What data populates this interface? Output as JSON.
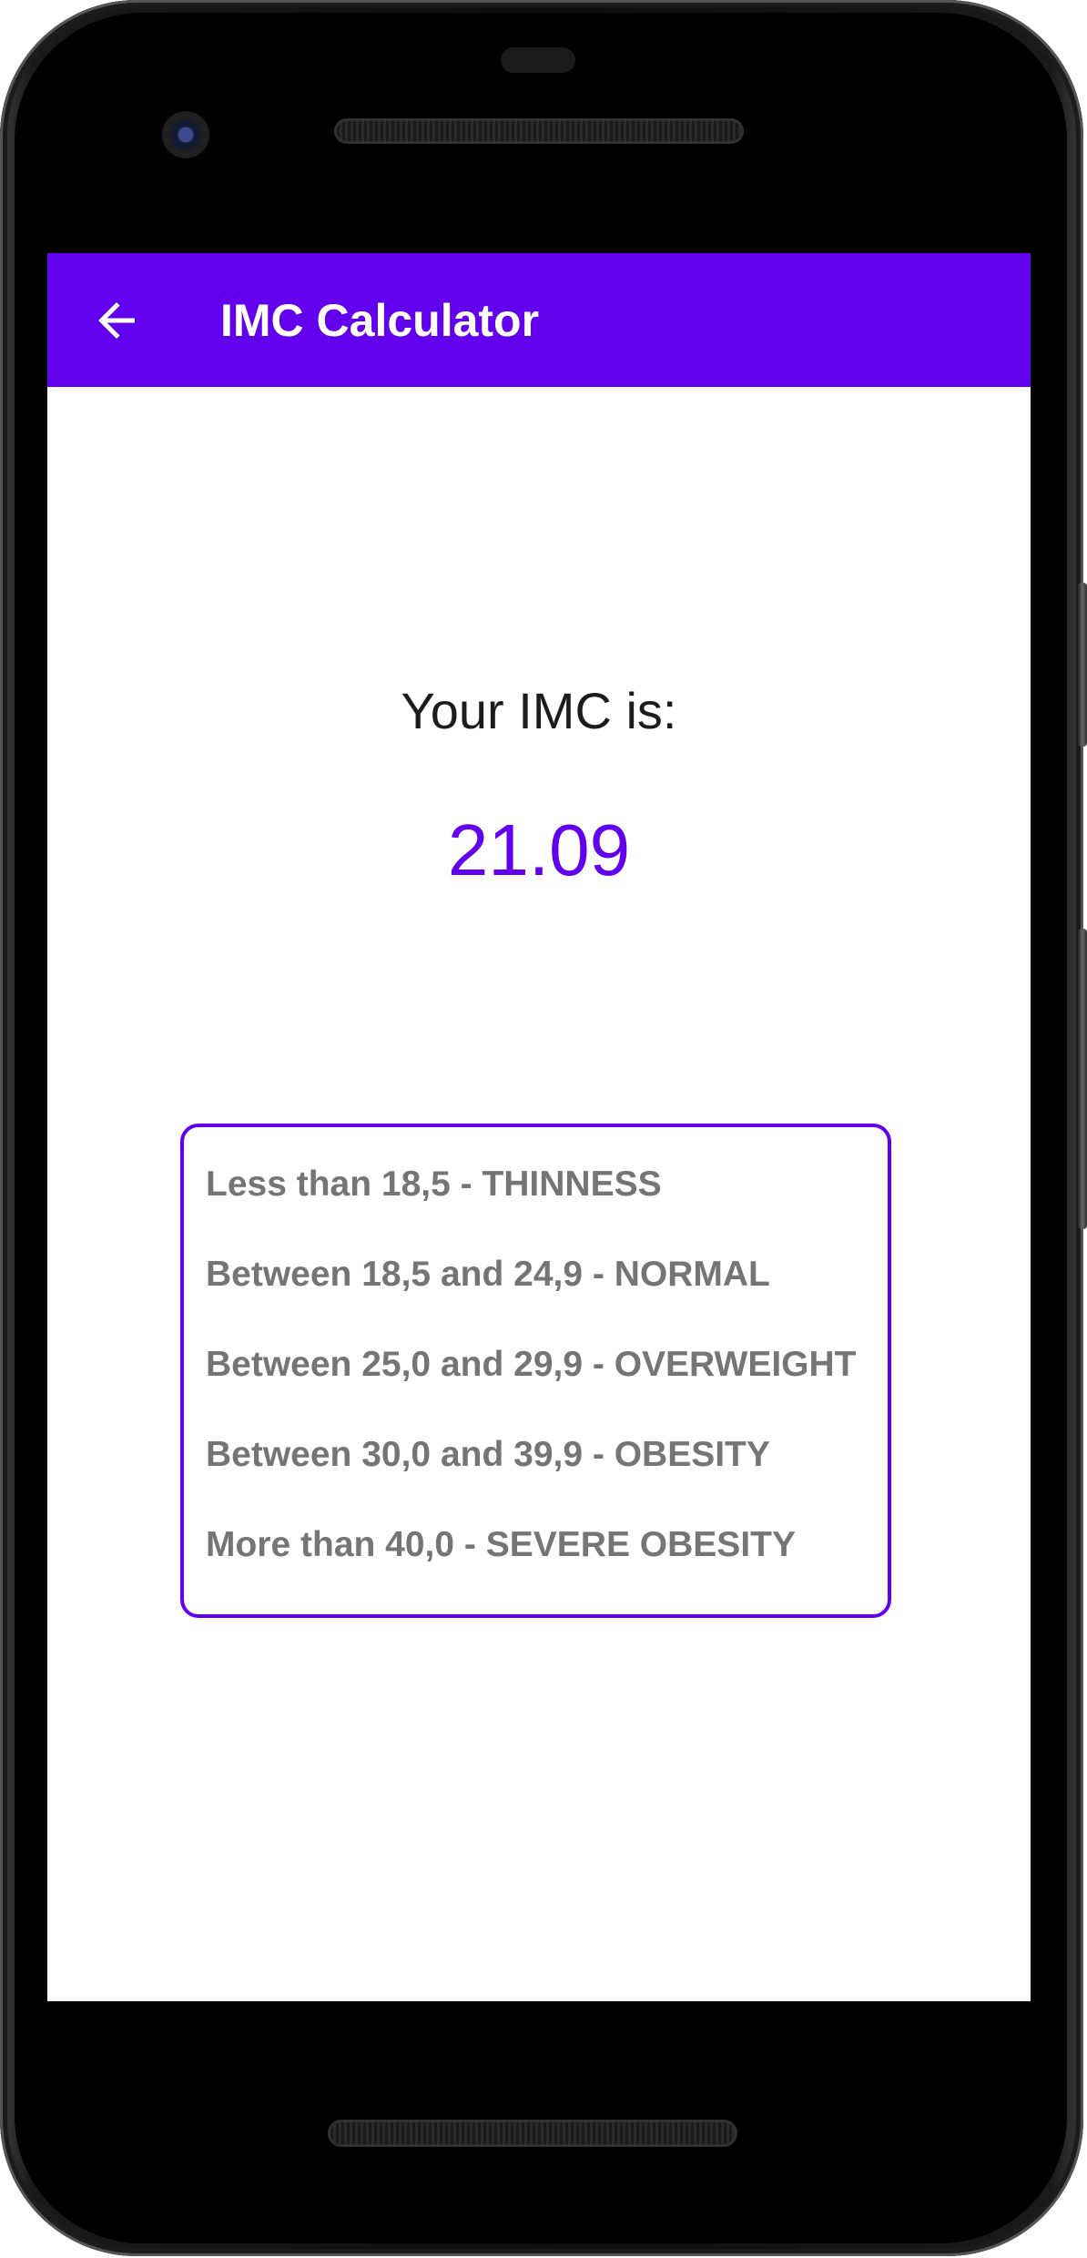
{
  "app_bar": {
    "title": "IMC Calculator",
    "back_icon": "arrow-back-icon",
    "color": "#6200EE"
  },
  "result": {
    "label": "Your IMC is:",
    "value": "21.09",
    "value_color": "#6200EE"
  },
  "ranges": {
    "border_color": "#6200EE",
    "items": [
      "Less than 18,5 - THINNESS",
      "Between 18,5 and 24,9 - NORMAL",
      "Between 25,0 and 29,9 - OVERWEIGHT",
      "Between 30,0 and 39,9 - OBESITY",
      "More than 40,0 - SEVERE OBESITY"
    ]
  }
}
